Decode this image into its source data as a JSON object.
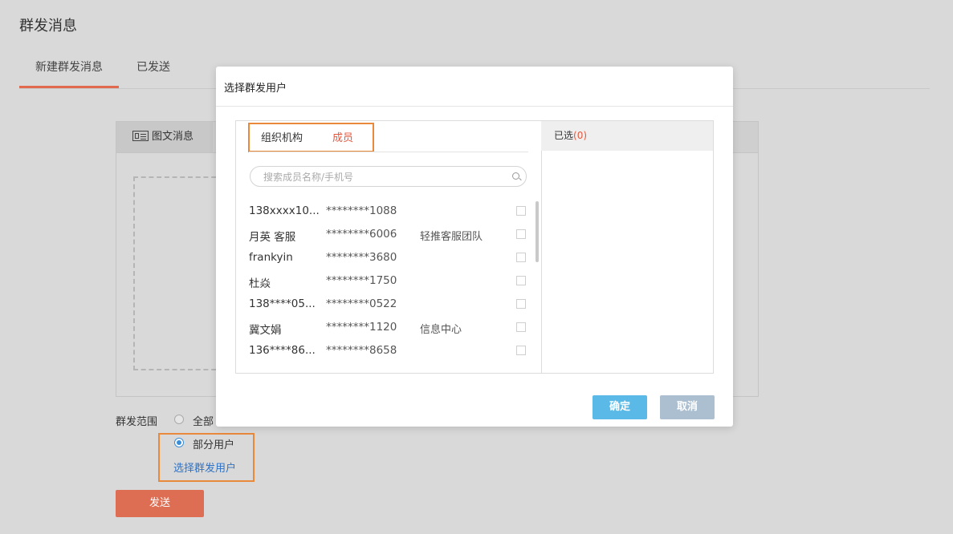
{
  "page": {
    "title": "群发消息",
    "tabs": [
      {
        "label": "新建群发消息"
      },
      {
        "label": "已发送"
      }
    ]
  },
  "editor": {
    "tab_label": "图文消息",
    "tab_icon": "news-icon"
  },
  "range": {
    "label": "群发范围",
    "options": [
      {
        "label": "全部",
        "selected": false
      },
      {
        "label": "部分用户",
        "selected": true
      }
    ],
    "select_link": "选择群发用户"
  },
  "send_label": "发送",
  "modal": {
    "title": "选择群发用户",
    "tabs": [
      {
        "label": "组织机构"
      },
      {
        "label": "成员",
        "active": true
      }
    ],
    "search_placeholder": "搜索成员名称/手机号",
    "members": [
      {
        "name": "138xxxx10...",
        "phone": "********1088",
        "dept": ""
      },
      {
        "name": "月英 客服",
        "phone": "********6006",
        "dept": "轻推客服团队"
      },
      {
        "name": "frankyin",
        "phone": "********3680",
        "dept": ""
      },
      {
        "name": "杜焱",
        "phone": "********1750",
        "dept": ""
      },
      {
        "name": "138****05...",
        "phone": "********0522",
        "dept": ""
      },
      {
        "name": "冀文娟",
        "phone": "********1120",
        "dept": "信息中心"
      },
      {
        "name": "136****86...",
        "phone": "********8658",
        "dept": ""
      }
    ],
    "selected_label": "已选",
    "selected_count": "(0)",
    "ok_label": "确定",
    "cancel_label": "取消"
  },
  "colors": {
    "accent": "#e0694e",
    "highlight_border": "#e9893c",
    "link": "#2f72c5",
    "ok_button": "#5ab9e6",
    "cancel_button": "#abbfd1"
  }
}
